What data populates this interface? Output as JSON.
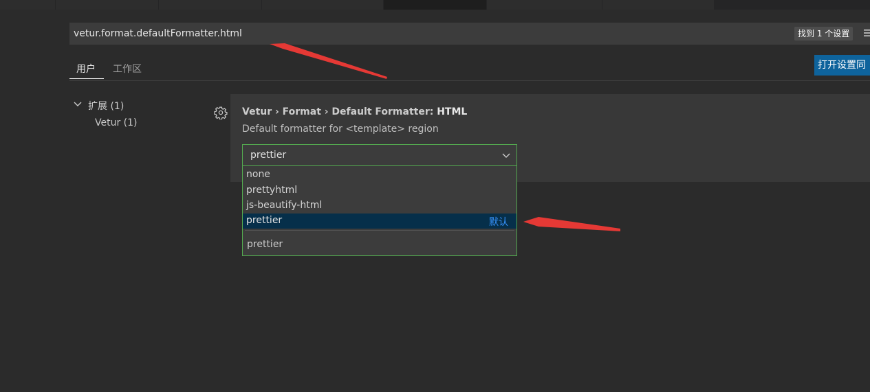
{
  "search": {
    "value": "vetur.format.defaultFormatter.html",
    "result_count": "找到 1 个设置"
  },
  "scope_tabs": [
    {
      "label": "用户",
      "active": true
    },
    {
      "label": "工作区",
      "active": false
    }
  ],
  "sync_button_label": "打开设置同",
  "toc": {
    "group_label": "扩展 (1)",
    "item_label": "Vetur (1)"
  },
  "setting": {
    "breadcrumb": "Vetur › Format › Default Formatter: ",
    "name": "HTML",
    "description": "Default formatter for <template> region",
    "selected_value": "prettier"
  },
  "dropdown": {
    "options": [
      {
        "label": "none"
      },
      {
        "label": "prettyhtml"
      },
      {
        "label": "js-beautify-html"
      },
      {
        "label": "prettier",
        "tag": "默认",
        "highlighted": true
      }
    ],
    "footer_description": "prettier"
  },
  "colors": {
    "focus_border": "#53a94f",
    "accent_button": "#0e639c",
    "selection_bg": "#062f4a",
    "default_tag": "#3794ff",
    "annotation_arrow": "#e53935"
  },
  "icons": [
    "settings-gear-icon",
    "chevron-down-icon",
    "filter-icon"
  ]
}
